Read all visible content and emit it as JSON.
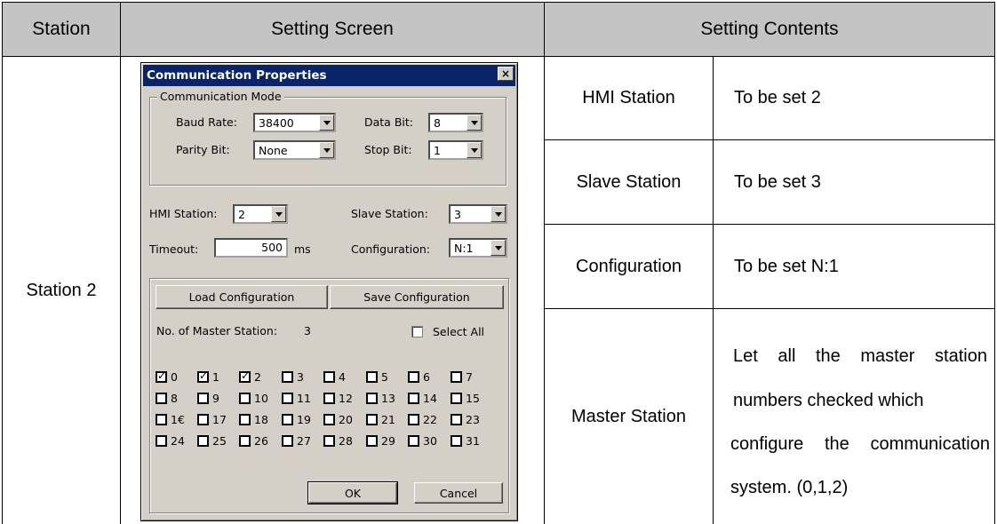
{
  "table": {
    "headers": [
      "Station",
      "Setting Screen",
      "Setting Contents"
    ],
    "station_label": "Station 2",
    "rows": [
      {
        "item": "HMI Station",
        "content": "To be set 2"
      },
      {
        "item": "Slave Station",
        "content": "To be set 3"
      },
      {
        "item": "Configuration",
        "content": "To be set N:1"
      },
      {
        "item": "Master Station",
        "content_lines": [
          [
            "Let",
            "all",
            "the",
            "master",
            "station"
          ],
          [
            "numbers checked which"
          ],
          [
            "configure",
            "the",
            "communication"
          ],
          [
            "system. (0,1,2)"
          ]
        ]
      }
    ]
  },
  "dialog": {
    "title": "Communication Properties",
    "close_glyph": "×",
    "comm_mode": {
      "legend": "Communication Mode",
      "baud_rate_label": "Baud Rate:",
      "baud_rate_value": "38400",
      "data_bit_label": "Data Bit:",
      "data_bit_value": "8",
      "parity_bit_label": "Parity Bit:",
      "parity_bit_value": "None",
      "stop_bit_label": "Stop Bit:",
      "stop_bit_value": "1"
    },
    "hmi_station_label": "HMI Station:",
    "hmi_station_value": "2",
    "slave_station_label": "Slave Station:",
    "slave_station_value": "3",
    "timeout_label": "Timeout:",
    "timeout_value": "500",
    "timeout_unit": "ms",
    "configuration_label": "Configuration:",
    "configuration_value": "N:1",
    "load_config_label": "Load Configuration",
    "save_config_label": "Save Configuration",
    "master_count_label": "No. of Master Station:",
    "master_count_value": "3",
    "select_all_label": "Select All",
    "select_all_checked": false,
    "stations": {
      "labels": [
        "0",
        "1",
        "2",
        "3",
        "4",
        "5",
        "6",
        "7",
        "8",
        "9",
        "10",
        "11",
        "12",
        "13",
        "14",
        "15",
        "1€",
        "17",
        "18",
        "19",
        "20",
        "21",
        "22",
        "23",
        "24",
        "25",
        "26",
        "27",
        "28",
        "29",
        "30",
        "31"
      ],
      "checked": [
        true,
        true,
        true,
        false,
        false,
        false,
        false,
        false,
        false,
        false,
        false,
        false,
        false,
        false,
        false,
        false,
        false,
        false,
        false,
        false,
        false,
        false,
        false,
        false,
        false,
        false,
        false,
        false,
        false,
        false,
        false,
        false
      ]
    },
    "ok_label": "OK",
    "cancel_label": "Cancel"
  }
}
